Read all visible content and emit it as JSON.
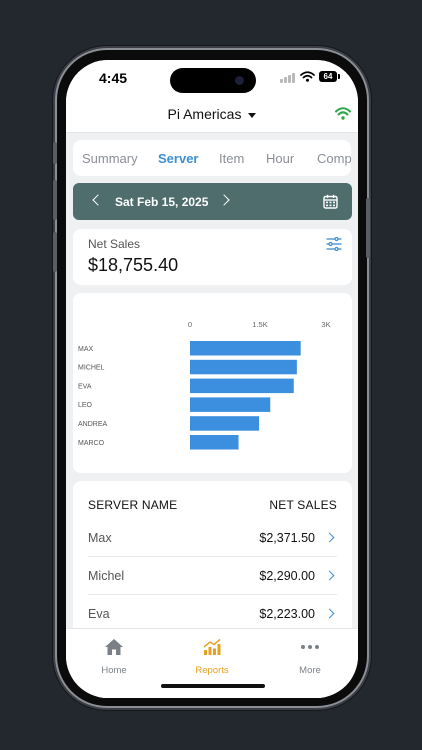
{
  "status": {
    "time": "4:45",
    "battery": "64"
  },
  "header": {
    "location": "Pi Americas"
  },
  "tabs": [
    {
      "label": "Summary",
      "active": false
    },
    {
      "label": "Server",
      "active": true
    },
    {
      "label": "Item",
      "active": false
    },
    {
      "label": "Hour",
      "active": false
    },
    {
      "label": "Compa",
      "active": false
    }
  ],
  "date_nav": {
    "date": "Sat Feb 15, 2025"
  },
  "summary": {
    "label": "Net Sales",
    "value": "$18,755.40"
  },
  "chart_data": {
    "type": "bar",
    "orientation": "horizontal",
    "categories": [
      "MAX",
      "MICHEL",
      "EVA",
      "LEO",
      "ANDREA",
      "MARCO"
    ],
    "values": [
      2371.5,
      2290.0,
      2223.0,
      1720,
      1480,
      1040
    ],
    "xlim": [
      0,
      3000
    ],
    "xticks": [
      "0",
      "1.5K",
      "3K"
    ],
    "bar_color": "#3b8fde"
  },
  "table": {
    "header_name": "SERVER NAME",
    "header_sales": "NET SALES",
    "rows": [
      {
        "name": "Max",
        "value": "$2,371.50"
      },
      {
        "name": "Michel",
        "value": "$2,290.00"
      },
      {
        "name": "Eva",
        "value": "$2,223.00"
      }
    ]
  },
  "tabbar": {
    "home": "Home",
    "reports": "Reports",
    "more": "More"
  },
  "colors": {
    "accent": "#3e8fd3",
    "datebar": "#4f6d6c",
    "active_tab": "#e8a020",
    "wifi_green": "#2aa84a"
  }
}
